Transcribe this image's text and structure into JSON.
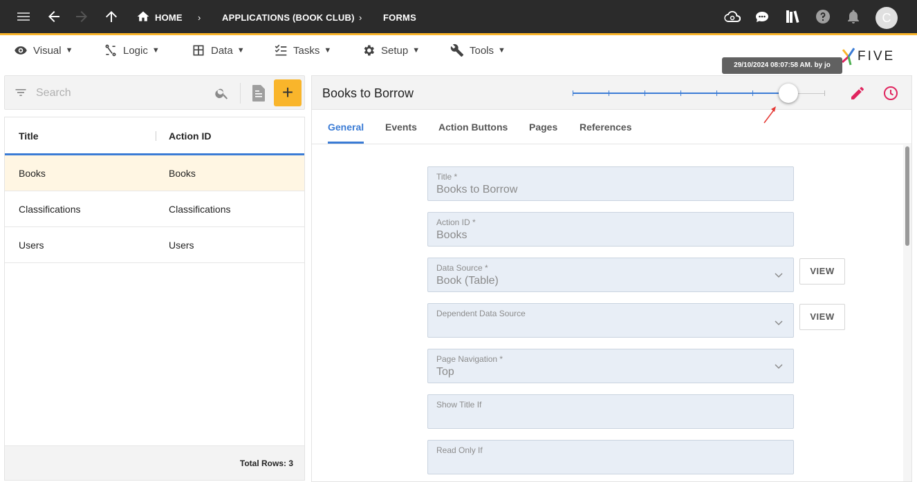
{
  "topbar": {
    "breadcrumbs": [
      "HOME",
      "APPLICATIONS (BOOK CLUB)",
      "FORMS"
    ],
    "avatar_letter": "C"
  },
  "menu": [
    {
      "label": "Visual",
      "icon": "eye-icon"
    },
    {
      "label": "Logic",
      "icon": "logic-icon"
    },
    {
      "label": "Data",
      "icon": "table-icon"
    },
    {
      "label": "Tasks",
      "icon": "tasks-icon"
    },
    {
      "label": "Setup",
      "icon": "gear-icon"
    },
    {
      "label": "Tools",
      "icon": "tools-icon"
    }
  ],
  "logo": {
    "text": "FIVE"
  },
  "left": {
    "search_placeholder": "Search",
    "columns": [
      "Title",
      "Action ID"
    ],
    "rows": [
      [
        "Books",
        "Books"
      ],
      [
        "Classifications",
        "Classifications"
      ],
      [
        "Users",
        "Users"
      ]
    ],
    "selected_row": 0,
    "total_rows": "Total Rows: 3"
  },
  "form": {
    "title": "Books to Borrow",
    "history_tooltip": "29/10/2024 08:07:58 AM. by jo",
    "history_slider": {
      "steps": 7,
      "position": 6
    },
    "tabs": [
      "General",
      "Events",
      "Action Buttons",
      "Pages",
      "References"
    ],
    "active_tab": 0,
    "fields": [
      {
        "label": "Title *",
        "value": "Books to Borrow",
        "dropdown": false,
        "view": false
      },
      {
        "label": "Action ID *",
        "value": "Books",
        "dropdown": false,
        "view": false
      },
      {
        "label": "Data Source *",
        "value": "Book (Table)",
        "dropdown": true,
        "view": true
      },
      {
        "label": "Dependent Data Source",
        "value": "",
        "dropdown": true,
        "view": true
      },
      {
        "label": "Page Navigation *",
        "value": "Top",
        "dropdown": true,
        "view": false
      },
      {
        "label": "Show Title If",
        "value": "",
        "dropdown": false,
        "view": false
      },
      {
        "label": "Read Only If",
        "value": "",
        "dropdown": false,
        "view": false
      }
    ],
    "view_label": "VIEW"
  },
  "colors": {
    "accent": "#f9b52b",
    "primary": "#3a7bd5",
    "edit": "#e0245e",
    "topbar": "#2b2b2b"
  }
}
